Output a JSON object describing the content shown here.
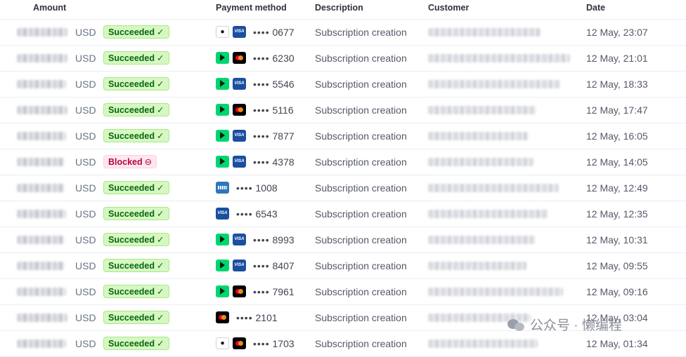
{
  "headers": {
    "amount": "Amount",
    "payment_method": "Payment method",
    "description": "Description",
    "customer": "Customer",
    "date": "Date"
  },
  "rows": [
    {
      "currency": "USD",
      "status": "Succeeded",
      "status_kind": "ok",
      "icons": [
        "apple-pay-icon",
        "visa-icon"
      ],
      "dots": "••••",
      "last4": "0677",
      "description": "Subscription creation",
      "date": "12 May, 23:07"
    },
    {
      "currency": "USD",
      "status": "Succeeded",
      "status_kind": "ok",
      "icons": [
        "link-icon",
        "mastercard-icon"
      ],
      "dots": "••••",
      "last4": "6230",
      "description": "Subscription creation",
      "date": "12 May, 21:01"
    },
    {
      "currency": "USD",
      "status": "Succeeded",
      "status_kind": "ok",
      "icons": [
        "link-icon",
        "visa-icon"
      ],
      "dots": "••••",
      "last4": "5546",
      "description": "Subscription creation",
      "date": "12 May, 18:33"
    },
    {
      "currency": "USD",
      "status": "Succeeded",
      "status_kind": "ok",
      "icons": [
        "link-icon",
        "mastercard-icon"
      ],
      "dots": "••••",
      "last4": "5116",
      "description": "Subscription creation",
      "date": "12 May, 17:47"
    },
    {
      "currency": "USD",
      "status": "Succeeded",
      "status_kind": "ok",
      "icons": [
        "link-icon",
        "visa-icon"
      ],
      "dots": "••••",
      "last4": "7877",
      "description": "Subscription creation",
      "date": "12 May, 16:05"
    },
    {
      "currency": "USD",
      "status": "Blocked",
      "status_kind": "blocked",
      "icons": [
        "link-icon",
        "visa-icon"
      ],
      "dots": "••••",
      "last4": "4378",
      "description": "Subscription creation",
      "date": "12 May, 14:05"
    },
    {
      "currency": "USD",
      "status": "Succeeded",
      "status_kind": "ok",
      "icons": [
        "amex-icon"
      ],
      "dots": "••••",
      "last4": "1008",
      "description": "Subscription creation",
      "date": "12 May, 12:49"
    },
    {
      "currency": "USD",
      "status": "Succeeded",
      "status_kind": "ok",
      "icons": [
        "visa-icon"
      ],
      "dots": "••••",
      "last4": "6543",
      "description": "Subscription creation",
      "date": "12 May, 12:35"
    },
    {
      "currency": "USD",
      "status": "Succeeded",
      "status_kind": "ok",
      "icons": [
        "link-icon",
        "visa-icon"
      ],
      "dots": "••••",
      "last4": "8993",
      "description": "Subscription creation",
      "date": "12 May, 10:31"
    },
    {
      "currency": "USD",
      "status": "Succeeded",
      "status_kind": "ok",
      "icons": [
        "link-icon",
        "visa-icon"
      ],
      "dots": "••••",
      "last4": "8407",
      "description": "Subscription creation",
      "date": "12 May, 09:55"
    },
    {
      "currency": "USD",
      "status": "Succeeded",
      "status_kind": "ok",
      "icons": [
        "link-icon",
        "mastercard-icon"
      ],
      "dots": "••••",
      "last4": "7961",
      "description": "Subscription creation",
      "date": "12 May, 09:16"
    },
    {
      "currency": "USD",
      "status": "Succeeded",
      "status_kind": "ok",
      "icons": [
        "mastercard-icon"
      ],
      "dots": "••••",
      "last4": "2101",
      "description": "Subscription creation",
      "date": "12 May, 03:04"
    },
    {
      "currency": "USD",
      "status": "Succeeded",
      "status_kind": "ok",
      "icons": [
        "apple-pay-icon",
        "mastercard-icon"
      ],
      "dots": "••••",
      "last4": "1703",
      "description": "Subscription creation",
      "date": "12 May, 01:34"
    }
  ],
  "watermark": "公众号 · 懒编程",
  "colors": {
    "succeeded_bg": "#d7f7c2",
    "succeeded_text": "#05690d",
    "blocked_bg": "#ffe7f2",
    "blocked_text": "#b3093c",
    "link_green": "#00d66f",
    "visa_blue": "#1a4fa0"
  }
}
